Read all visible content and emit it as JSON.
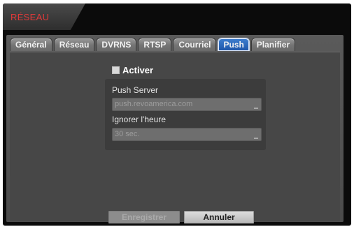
{
  "title": "RÉSEAU",
  "tabs": [
    {
      "label": "Général",
      "active": false
    },
    {
      "label": "Réseau",
      "active": false
    },
    {
      "label": "DVRNS",
      "active": false
    },
    {
      "label": "RTSP",
      "active": false
    },
    {
      "label": "Courriel",
      "active": false
    },
    {
      "label": "Push",
      "active": true
    },
    {
      "label": "Planifier",
      "active": false
    }
  ],
  "push": {
    "enable_label": "Activer",
    "enabled": false,
    "server_label": "Push Server",
    "server_value": "push.revoamerica.com",
    "ignore_label": "Ignorer l'heure",
    "ignore_value": "30 sec."
  },
  "buttons": {
    "save_label": "Enregistrer",
    "cancel_label": "Annuler"
  },
  "colors": {
    "title": "#e03a3a",
    "active_tab": "#2b66bd"
  }
}
